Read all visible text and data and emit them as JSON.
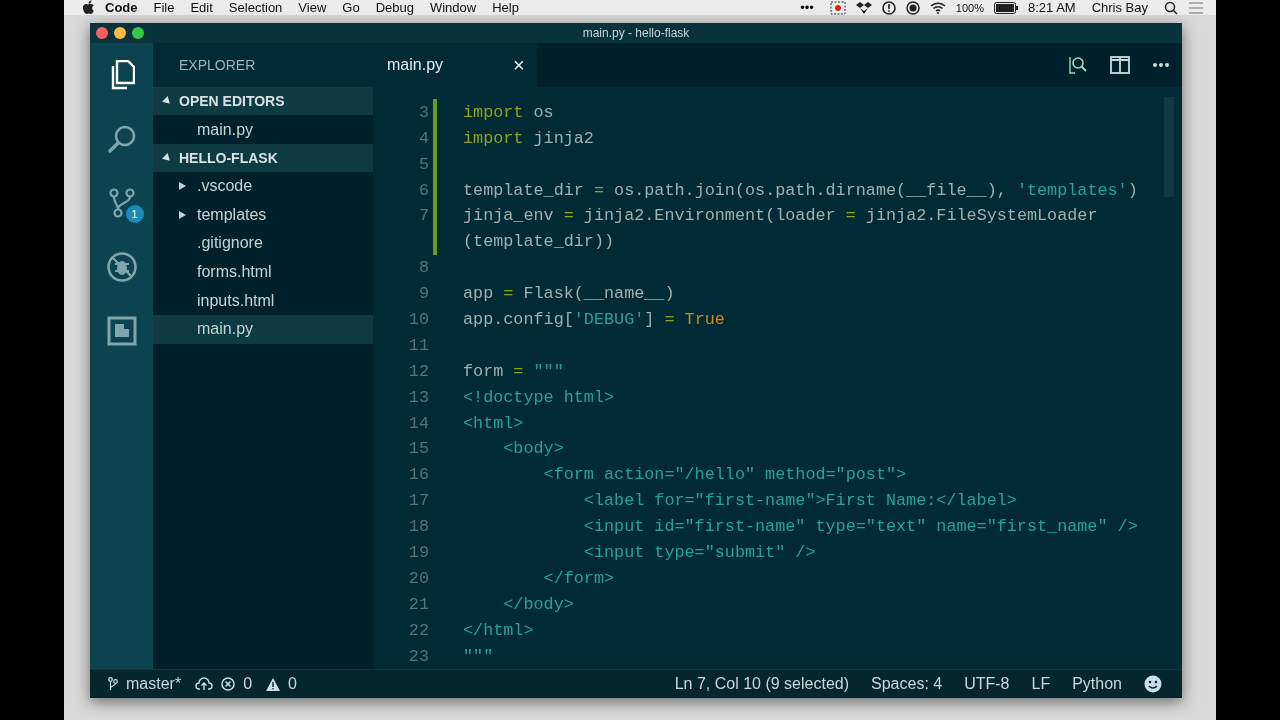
{
  "menu_bar": {
    "app": "Code",
    "items": [
      "File",
      "Edit",
      "Selection",
      "View",
      "Go",
      "Debug",
      "Window",
      "Help"
    ],
    "more": "•••",
    "battery": "100%",
    "time": "8:21 AM",
    "user": "Chris Bay"
  },
  "window": {
    "title": "main.py - hello-flask"
  },
  "activity_bar": [
    {
      "kind": "files",
      "selected": true
    },
    {
      "kind": "search",
      "selected": false
    },
    {
      "kind": "git",
      "selected": false,
      "badge": "1"
    },
    {
      "kind": "debug",
      "selected": false
    },
    {
      "kind": "extensions",
      "selected": false
    }
  ],
  "sidebar": {
    "title": "EXPLORER",
    "sections": [
      {
        "label": "OPEN EDITORS",
        "expanded": true,
        "items": [
          {
            "label": "main.py",
            "folder": false,
            "selected": false
          }
        ]
      },
      {
        "label": "HELLO-FLASK",
        "expanded": true,
        "items": [
          {
            "label": ".vscode",
            "folder": true,
            "expanded": false,
            "selected": false
          },
          {
            "label": "templates",
            "folder": true,
            "expanded": false,
            "selected": false
          },
          {
            "label": ".gitignore",
            "folder": false,
            "selected": false
          },
          {
            "label": "forms.html",
            "folder": false,
            "selected": false
          },
          {
            "label": "inputs.html",
            "folder": false,
            "selected": false
          },
          {
            "label": "main.py",
            "folder": false,
            "selected": true
          }
        ]
      }
    ]
  },
  "tabs": [
    {
      "label": "main.py",
      "selected": true,
      "close": "×"
    }
  ],
  "editor": {
    "lines": [
      {
        "number": "3",
        "modified": true,
        "tokens": [
          {
            "kind": "keyword",
            "text": "import"
          },
          {
            "kind": "plain",
            "text": " os"
          }
        ]
      },
      {
        "number": "4",
        "modified": true,
        "tokens": [
          {
            "kind": "keyword",
            "text": "import"
          },
          {
            "kind": "plain",
            "text": " jinja2"
          }
        ]
      },
      {
        "number": "5",
        "modified": true
      },
      {
        "number": "6",
        "modified": true,
        "tokens": [
          {
            "kind": "plain",
            "text": "template_dir "
          },
          {
            "kind": "keyword",
            "text": "="
          },
          {
            "kind": "plain",
            "text": " os.path.join(os.path.dirname(__file__), "
          },
          {
            "kind": "string",
            "text": "'templates'"
          },
          {
            "kind": "plain",
            "text": ")"
          }
        ]
      },
      {
        "number": "7",
        "modified": true,
        "tokens": [
          {
            "kind": "plain",
            "text": "jinja_env "
          },
          {
            "kind": "keyword",
            "text": "="
          },
          {
            "kind": "plain",
            "text": " jinja2.Environment(loader "
          },
          {
            "kind": "keyword",
            "text": "="
          },
          {
            "kind": "plain",
            "text": " jinja2.FileSystemLoader"
          }
        ]
      },
      {
        "modified": true,
        "tokens": [
          {
            "kind": "plain",
            "text": "(template_dir))"
          }
        ]
      },
      {
        "number": "8",
        "modified": false
      },
      {
        "number": "9",
        "modified": false,
        "tokens": [
          {
            "kind": "plain",
            "text": "app "
          },
          {
            "kind": "keyword",
            "text": "="
          },
          {
            "kind": "plain",
            "text": " Flask(__name__)"
          }
        ]
      },
      {
        "number": "10",
        "modified": false,
        "tokens": [
          {
            "kind": "plain",
            "text": "app.config["
          },
          {
            "kind": "string",
            "text": "'DEBUG'"
          },
          {
            "kind": "plain",
            "text": "] "
          },
          {
            "kind": "keyword",
            "text": "= "
          },
          {
            "kind": "constant",
            "text": "True"
          }
        ]
      },
      {
        "number": "11",
        "modified": false
      },
      {
        "number": "12",
        "modified": false,
        "tokens": [
          {
            "kind": "plain",
            "text": "form "
          },
          {
            "kind": "keyword",
            "text": "= "
          },
          {
            "kind": "string",
            "text": "\"\"\""
          }
        ]
      },
      {
        "number": "13",
        "modified": false,
        "tokens": [
          {
            "kind": "string",
            "text": "<!doctype html>"
          }
        ]
      },
      {
        "number": "14",
        "modified": false,
        "tokens": [
          {
            "kind": "string",
            "text": "<html>"
          }
        ]
      },
      {
        "number": "15",
        "modified": false,
        "tokens": [
          {
            "kind": "string",
            "text": "    <body>"
          }
        ]
      },
      {
        "number": "16",
        "modified": false,
        "tokens": [
          {
            "kind": "string",
            "text": "        <form action=\"/hello\" method=\"post\">"
          }
        ]
      },
      {
        "number": "17",
        "modified": false,
        "tokens": [
          {
            "kind": "string",
            "text": "            <label for=\"first-name\">First Name:</label>"
          }
        ]
      },
      {
        "number": "18",
        "modified": false,
        "tokens": [
          {
            "kind": "string",
            "text": "            <input id=\"first-name\" type=\"text\" name=\"first_name\" />"
          }
        ]
      },
      {
        "number": "19",
        "modified": false,
        "tokens": [
          {
            "kind": "string",
            "text": "            <input type=\"submit\" />"
          }
        ]
      },
      {
        "number": "20",
        "modified": false,
        "tokens": [
          {
            "kind": "string",
            "text": "        </form>"
          }
        ]
      },
      {
        "number": "21",
        "modified": false,
        "tokens": [
          {
            "kind": "string",
            "text": "    </body>"
          }
        ]
      },
      {
        "number": "22",
        "modified": false,
        "tokens": [
          {
            "kind": "string",
            "text": "</html>"
          }
        ]
      },
      {
        "number": "23",
        "modified": false,
        "tokens": [
          {
            "kind": "string",
            "text": "\"\"\""
          }
        ]
      }
    ]
  },
  "status_bar": {
    "branch": "master*",
    "errors": "0",
    "warnings": "0",
    "items": [
      "Ln 7, Col 10 (9 selected)",
      "Spaces: 4",
      "UTF-8",
      "LF",
      "Python"
    ]
  }
}
